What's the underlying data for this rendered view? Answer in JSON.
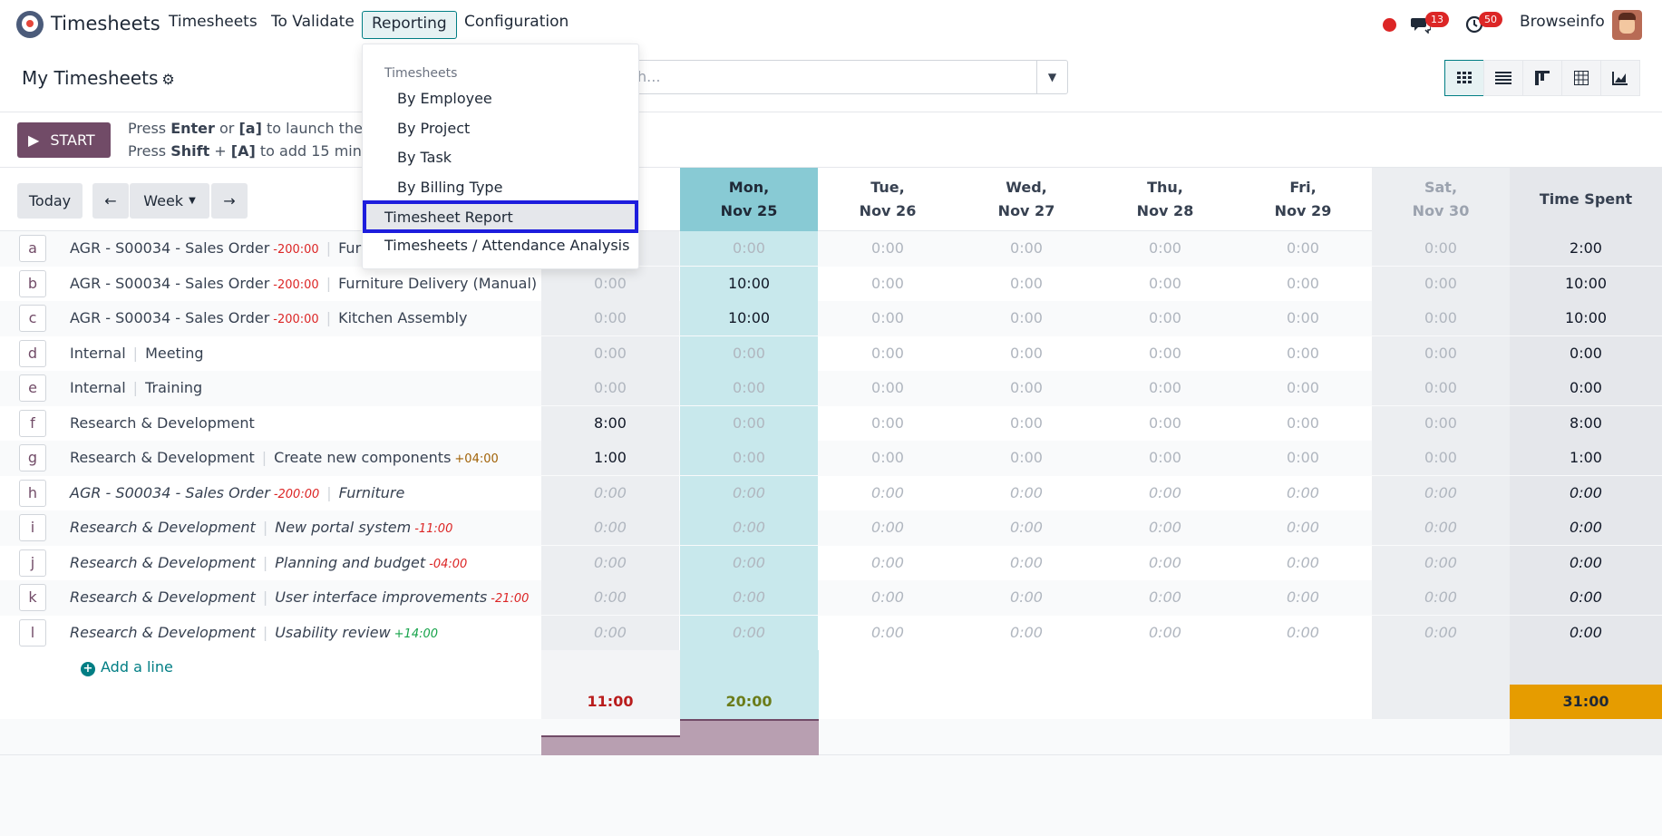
{
  "app": {
    "title": "Timesheets"
  },
  "menu": {
    "items": [
      "Timesheets",
      "To Validate",
      "Reporting",
      "Configuration"
    ]
  },
  "topright": {
    "chat_badge": "13",
    "activity_badge": "50",
    "company": "Browseinfo"
  },
  "control": {
    "page_title": "My Timesheets",
    "search_placeholder": "h..."
  },
  "start": {
    "label": "START",
    "hint1_a": "Press ",
    "hint1_key": "Enter",
    "hint1_b": " or ",
    "hint1_key2": "[a]",
    "hint1_c": " to launch the tir",
    "hint2_a": "Press ",
    "hint2_key": "Shift",
    "hint2_b": " + ",
    "hint2_key2": "[A]",
    "hint2_c": " to add 15 min"
  },
  "grid": {
    "today_label": "Today",
    "range_label": "Week",
    "days": [
      {
        "line1": "Mon,",
        "line2": "Nov 25"
      },
      {
        "line1": "Tue,",
        "line2": "Nov 26"
      },
      {
        "line1": "Wed,",
        "line2": "Nov 27"
      },
      {
        "line1": "Thu,",
        "line2": "Nov 28"
      },
      {
        "line1": "Fri,",
        "line2": "Nov 29"
      },
      {
        "line1": "Sat,",
        "line2": "Nov 30"
      }
    ],
    "spent_label": "Time Spent",
    "add_line": "Add a line",
    "totals": {
      "first": "11:00",
      "mon": "20:00",
      "spent": "31:00"
    },
    "colors": {
      "primary": "#714b67",
      "accent": "#017e84",
      "today": "#88cad4",
      "total_spent": "#e69c00",
      "total_first": "#b91c1c",
      "total_mon": "#6b7c1a"
    }
  },
  "rows": [
    {
      "key": "a",
      "project": "AGR - S00034 - Sales Order",
      "delta": "-200:00",
      "delta_kind": "neg",
      "task": "Furn",
      "cells": [
        "",
        "0:00",
        "0:00",
        "0:00",
        "0:00",
        "0:00",
        "0:00"
      ],
      "spent": "2:00",
      "italic": false
    },
    {
      "key": "b",
      "project": "AGR - S00034 - Sales Order",
      "delta": "-200:00",
      "delta_kind": "neg",
      "task": "Furniture Delivery (Manual)",
      "cells": [
        "0:00",
        "10:00",
        "0:00",
        "0:00",
        "0:00",
        "0:00",
        "0:00"
      ],
      "spent": "10:00",
      "italic": false
    },
    {
      "key": "c",
      "project": "AGR - S00034 - Sales Order",
      "delta": "-200:00",
      "delta_kind": "neg",
      "task": "Kitchen Assembly",
      "cells": [
        "0:00",
        "10:00",
        "0:00",
        "0:00",
        "0:00",
        "0:00",
        "0:00"
      ],
      "spent": "10:00",
      "italic": false
    },
    {
      "key": "d",
      "project": "Internal",
      "delta": "",
      "delta_kind": "",
      "task": "Meeting",
      "cells": [
        "0:00",
        "0:00",
        "0:00",
        "0:00",
        "0:00",
        "0:00",
        "0:00"
      ],
      "spent": "0:00",
      "italic": false
    },
    {
      "key": "e",
      "project": "Internal",
      "delta": "",
      "delta_kind": "",
      "task": "Training",
      "cells": [
        "0:00",
        "0:00",
        "0:00",
        "0:00",
        "0:00",
        "0:00",
        "0:00"
      ],
      "spent": "0:00",
      "italic": false
    },
    {
      "key": "f",
      "project": "Research & Development",
      "delta": "",
      "delta_kind": "",
      "task": "",
      "cells": [
        "8:00",
        "0:00",
        "0:00",
        "0:00",
        "0:00",
        "0:00",
        "0:00"
      ],
      "spent": "8:00",
      "italic": false
    },
    {
      "key": "g",
      "project": "Research & Development",
      "delta": "",
      "delta_kind": "",
      "task": "Create new components",
      "task_delta": "+04:00",
      "task_delta_kind": "pos-o",
      "cells": [
        "1:00",
        "0:00",
        "0:00",
        "0:00",
        "0:00",
        "0:00",
        "0:00"
      ],
      "spent": "1:00",
      "italic": false
    },
    {
      "key": "h",
      "project": "AGR - S00034 - Sales Order",
      "delta": "-200:00",
      "delta_kind": "neg",
      "task": "Furniture",
      "cells": [
        "0:00",
        "0:00",
        "0:00",
        "0:00",
        "0:00",
        "0:00",
        "0:00"
      ],
      "spent": "0:00",
      "italic": true
    },
    {
      "key": "i",
      "project": "Research & Development",
      "delta": "",
      "delta_kind": "",
      "task": "New portal system",
      "task_delta": "-11:00",
      "task_delta_kind": "neg",
      "cells": [
        "0:00",
        "0:00",
        "0:00",
        "0:00",
        "0:00",
        "0:00",
        "0:00"
      ],
      "spent": "0:00",
      "italic": true
    },
    {
      "key": "j",
      "project": "Research & Development",
      "delta": "",
      "delta_kind": "",
      "task": "Planning and budget",
      "task_delta": "-04:00",
      "task_delta_kind": "neg",
      "cells": [
        "0:00",
        "0:00",
        "0:00",
        "0:00",
        "0:00",
        "0:00",
        "0:00"
      ],
      "spent": "0:00",
      "italic": true
    },
    {
      "key": "k",
      "project": "Research & Development",
      "delta": "",
      "delta_kind": "",
      "task": "User interface improvements",
      "task_delta": "-21:00",
      "task_delta_kind": "neg",
      "cells": [
        "0:00",
        "0:00",
        "0:00",
        "0:00",
        "0:00",
        "0:00",
        "0:00"
      ],
      "spent": "0:00",
      "italic": true
    },
    {
      "key": "l",
      "project": "Research & Development",
      "delta": "",
      "delta_kind": "",
      "task": "Usability review",
      "task_delta": "+14:00",
      "task_delta_kind": "pos-g",
      "cells": [
        "0:00",
        "0:00",
        "0:00",
        "0:00",
        "0:00",
        "0:00",
        "0:00"
      ],
      "spent": "0:00",
      "italic": true
    }
  ],
  "dropdown": {
    "header": "Timesheets",
    "items": [
      "By Employee",
      "By Project",
      "By Task",
      "By Billing Type"
    ],
    "highlighted": "Timesheet Report",
    "last": "Timesheets / Attendance Analysis"
  }
}
